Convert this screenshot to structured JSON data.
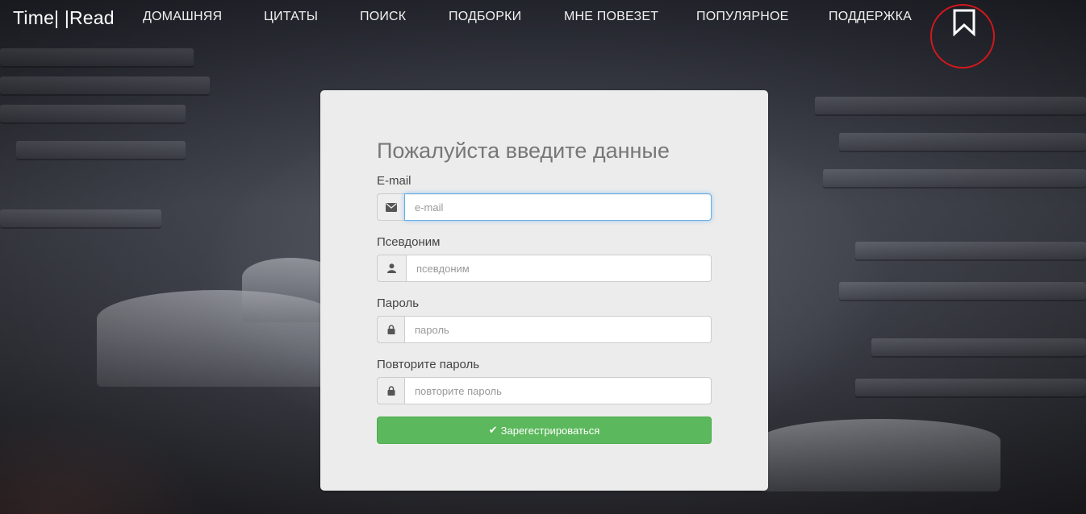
{
  "brand": "Time| |Read",
  "nav": {
    "items": [
      {
        "label": "ДОМАШНЯЯ"
      },
      {
        "label": "ЦИТАТЫ"
      },
      {
        "label": "ПОИСК"
      },
      {
        "label": "ПОДБОРКИ"
      },
      {
        "label": "МНЕ ПОВЕЗЕТ"
      },
      {
        "label": "ПОПУЛЯРНОЕ"
      },
      {
        "label": "ПОДДЕРЖКА"
      }
    ],
    "bookmark_icon": "bookmark-icon",
    "highlight_color": "#d4171c"
  },
  "form": {
    "title": "Пожалуйста введите данные",
    "fields": [
      {
        "label": "E-mail",
        "placeholder": "e-mail",
        "value": "",
        "icon": "envelope-icon"
      },
      {
        "label": "Псевдоним",
        "placeholder": "псевдоним",
        "value": "",
        "icon": "user-icon"
      },
      {
        "label": "Пароль",
        "placeholder": "пароль",
        "value": "",
        "icon": "lock-icon"
      },
      {
        "label": "Повторите пароль",
        "placeholder": "повторите пароль",
        "value": "",
        "icon": "lock-icon"
      }
    ],
    "submit_label": "Зарегестрироваться",
    "submit_icon": "check-icon",
    "submit_color": "#5cb85c"
  }
}
